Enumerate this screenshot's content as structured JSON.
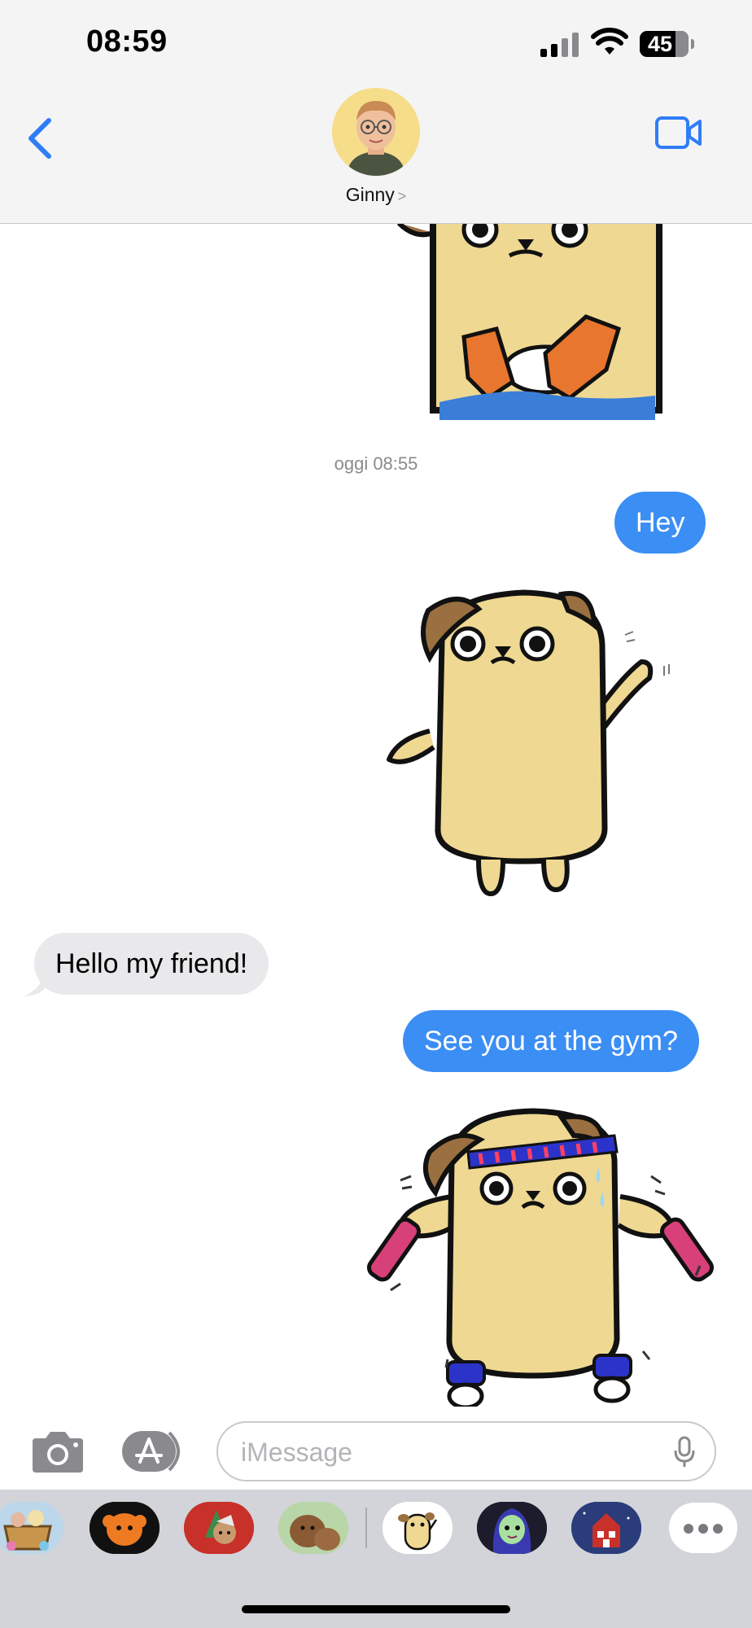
{
  "status_bar": {
    "time": "08:59",
    "battery": "45"
  },
  "header": {
    "contact_name": "Ginny",
    "name_chevron": ">"
  },
  "conversation": {
    "timestamp": "oggi 08:55",
    "messages": [
      {
        "direction": "outgoing",
        "text": "Hey"
      },
      {
        "direction": "incoming",
        "text": "Hello my friend!"
      },
      {
        "direction": "outgoing",
        "text": "See you at the gym?"
      }
    ]
  },
  "compose": {
    "placeholder": "iMessage"
  },
  "app_drawer": {
    "icons": [
      "sticker-basket-icon",
      "pumpkin-dog-icon",
      "christmas-bear-icon",
      "brown-dogs-icon",
      "waving-dog-icon",
      "witch-icon",
      "house-icon"
    ],
    "more_icon": "more-icon"
  },
  "colors": {
    "outgoing_bubble": "#3b8ef3",
    "incoming_bubble": "#e9e9eb",
    "accent": "#2f7df6",
    "dog_body": "#efd892"
  }
}
